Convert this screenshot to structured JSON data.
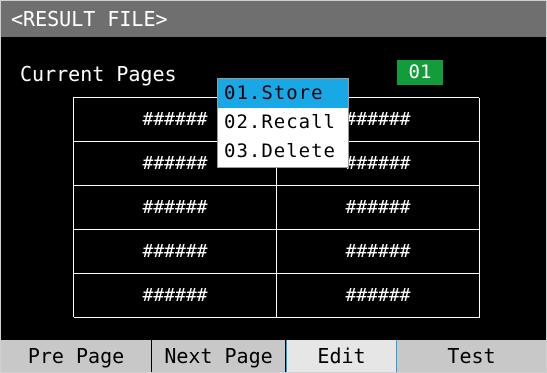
{
  "window": {
    "title": "<RESULT FILE>"
  },
  "header": {
    "current_pages_label": "Current Pages",
    "page_number": "01"
  },
  "grid": {
    "rows": [
      [
        "######",
        "######"
      ],
      [
        "######",
        "######"
      ],
      [
        "######",
        "######"
      ],
      [
        "######",
        "######"
      ],
      [
        "######",
        "######"
      ]
    ]
  },
  "menu": {
    "items": [
      {
        "label": "01.Store",
        "selected": true
      },
      {
        "label": "02.Recall",
        "selected": false
      },
      {
        "label": "03.Delete",
        "selected": false
      }
    ]
  },
  "softkeys": [
    {
      "label": "Pre Page"
    },
    {
      "label": "Next Page"
    },
    {
      "label": "Edit",
      "active": true
    },
    {
      "label": "Test"
    }
  ],
  "colors": {
    "titlebar": "#6f6f6f",
    "badge": "#129c3a",
    "menu_highlight": "#19a8e6",
    "background": "#000000"
  }
}
